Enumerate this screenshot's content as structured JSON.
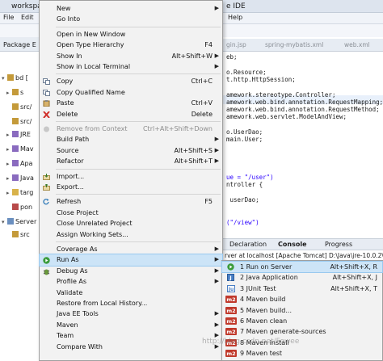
{
  "window": {
    "title_left": "workspac",
    "title_right": "e IDE"
  },
  "menubar": [
    "File",
    "Edit",
    "S",
    "Help"
  ],
  "package_explorer": {
    "tab": "Package E",
    "rows": [
      {
        "arrow": "▾",
        "label": "bd ["
      },
      {
        "arrow": "▸",
        "label": "s"
      },
      {
        "arrow": "",
        "label": "src/"
      },
      {
        "arrow": "",
        "label": "src/"
      },
      {
        "arrow": "▸",
        "label": "JRE"
      },
      {
        "arrow": "▸",
        "label": "Mav"
      },
      {
        "arrow": "▸",
        "label": "Apa"
      },
      {
        "arrow": "▸",
        "label": "Java"
      },
      {
        "arrow": "▸",
        "label": "targ"
      },
      {
        "arrow": "",
        "label": "pon"
      },
      {
        "arrow": "▾",
        "label": "Server"
      },
      {
        "arrow": "",
        "label": "src"
      }
    ]
  },
  "editor_tabs": [
    "gin.jsp",
    "spring-mybatis.xml",
    "web.xml"
  ],
  "code_lines": [
    "eb;",
    "",
    "o.Resource;",
    "t.http.HttpSession;",
    "",
    "amework.stereotype.Controller;",
    "amework.web.bind.annotation.RequestMapping;",
    "amework.web.bind.annotation.RequestMethod;",
    "amework.web.servlet.ModelAndView;",
    "",
    "o.UserDao;",
    "main.User;",
    "",
    "",
    "",
    "",
    "ue = \"/user\")",
    "ntroller {",
    "",
    " userDao;",
    "",
    "",
    "(\"/view\")"
  ],
  "console": {
    "tabs": [
      "Declaration",
      "Console",
      "Progress"
    ],
    "line": "rver at localhost [Apache Tomcat] D:\\Java\\jre-10.0.2\\bi"
  },
  "context_menu": [
    {
      "label": "New",
      "shortcut": "",
      "submenu": true
    },
    {
      "label": "Go Into",
      "shortcut": ""
    },
    {
      "sep": true
    },
    {
      "label": "Open in New Window",
      "shortcut": ""
    },
    {
      "label": "Open Type Hierarchy",
      "shortcut": "F4"
    },
    {
      "label": "Show In",
      "shortcut": "Alt+Shift+W",
      "submenu": true
    },
    {
      "label": "Show in Local Terminal",
      "shortcut": "",
      "submenu": true
    },
    {
      "sep": true
    },
    {
      "label": "Copy",
      "shortcut": "Ctrl+C",
      "icon": "copy-icon"
    },
    {
      "label": "Copy Qualified Name",
      "shortcut": "",
      "icon": "copy-icon"
    },
    {
      "label": "Paste",
      "shortcut": "Ctrl+V",
      "icon": "paste-icon"
    },
    {
      "label": "Delete",
      "shortcut": "Delete",
      "icon": "delete-icon"
    },
    {
      "sep": true
    },
    {
      "label": "Remove from Context",
      "shortcut": "Ctrl+Alt+Shift+Down",
      "disabled": true,
      "icon": "remove-context-icon"
    },
    {
      "label": "Build Path",
      "shortcut": "",
      "submenu": true
    },
    {
      "label": "Source",
      "shortcut": "Alt+Shift+S",
      "submenu": true
    },
    {
      "label": "Refactor",
      "shortcut": "Alt+Shift+T",
      "submenu": true
    },
    {
      "sep": true
    },
    {
      "label": "Import...",
      "shortcut": "",
      "icon": "import-icon"
    },
    {
      "label": "Export...",
      "shortcut": "",
      "icon": "export-icon"
    },
    {
      "sep": true
    },
    {
      "label": "Refresh",
      "shortcut": "F5",
      "icon": "refresh-icon"
    },
    {
      "label": "Close Project",
      "shortcut": ""
    },
    {
      "label": "Close Unrelated Project",
      "shortcut": ""
    },
    {
      "label": "Assign Working Sets...",
      "shortcut": ""
    },
    {
      "sep": true
    },
    {
      "label": "Coverage As",
      "shortcut": "",
      "submenu": true
    },
    {
      "label": "Run As",
      "shortcut": "",
      "submenu": true,
      "highlighted": true,
      "icon": "run-icon"
    },
    {
      "label": "Debug As",
      "shortcut": "",
      "submenu": true,
      "icon": "debug-icon"
    },
    {
      "label": "Profile As",
      "shortcut": "",
      "submenu": true
    },
    {
      "label": "Validate",
      "shortcut": ""
    },
    {
      "label": "Restore from Local History...",
      "shortcut": ""
    },
    {
      "label": "Java EE Tools",
      "shortcut": "",
      "submenu": true
    },
    {
      "label": "Maven",
      "shortcut": "",
      "submenu": true
    },
    {
      "label": "Team",
      "shortcut": "",
      "submenu": true
    },
    {
      "label": "Compare With",
      "shortcut": "",
      "submenu": true
    }
  ],
  "run_as_submenu": [
    {
      "label": "1 Run on Server",
      "shortcut": "Alt+Shift+X, R",
      "icon": "server-icon",
      "highlighted": true
    },
    {
      "label": "2 Java Application",
      "shortcut": "Alt+Shift+X, J",
      "icon": "java-app-icon"
    },
    {
      "label": "3 JUnit Test",
      "shortcut": "Alt+Shift+X, T",
      "icon": "junit-icon"
    },
    {
      "label": "4 Maven build",
      "shortcut": "",
      "icon": "maven-icon"
    },
    {
      "label": "5 Maven build...",
      "shortcut": "",
      "icon": "maven-icon"
    },
    {
      "label": "6 Maven clean",
      "shortcut": "",
      "icon": "maven-icon"
    },
    {
      "label": "7 Maven generate-sources",
      "shortcut": "",
      "icon": "maven-icon"
    },
    {
      "label": "8 Maven install",
      "shortcut": "",
      "icon": "maven-icon"
    },
    {
      "label": "9 Maven test",
      "shortcut": "",
      "icon": "maven-icon"
    }
  ],
  "watermark": "http://blog.csdn.net/Fowee",
  "colors": {
    "highlight": "#cce4f7",
    "menu_bg": "#f2f2f2",
    "string": "#2a00ff",
    "maven_badge": "#c0392b"
  }
}
